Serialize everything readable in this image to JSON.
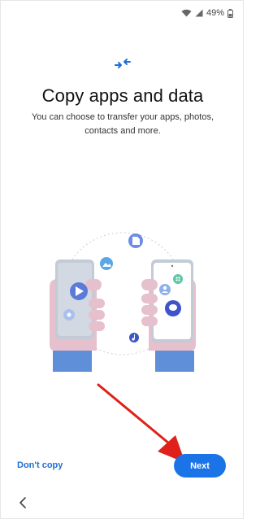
{
  "status_bar": {
    "battery": "49%",
    "icons": [
      "wifi-icon",
      "signal-icon",
      "battery-icon"
    ]
  },
  "header": {
    "icon": "transfer-arrows-icon",
    "title": "Copy apps and data",
    "subtitle": "You can choose to transfer your apps, photos, contacts and more."
  },
  "illustration": {
    "description_icons": [
      "file-icon",
      "image-icon",
      "play-icon",
      "settings-icon",
      "grid-icon",
      "contact-icon",
      "chat-icon",
      "music-icon"
    ]
  },
  "actions": {
    "dont_copy_label": "Don't copy",
    "next_label": "Next"
  },
  "nav": {
    "back_icon": "chevron-left-icon"
  },
  "colors": {
    "accent": "#1a74e8",
    "link": "#1d6fd6",
    "annotation": "#e0201a"
  }
}
